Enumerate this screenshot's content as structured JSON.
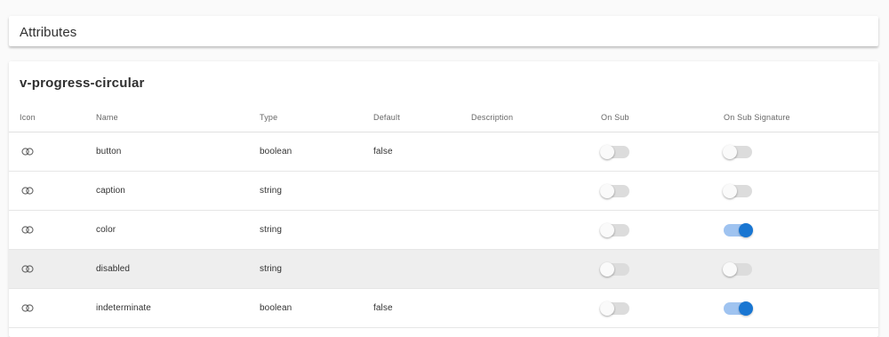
{
  "header": {
    "title": "Attributes"
  },
  "component": {
    "title": "v-progress-circular"
  },
  "table": {
    "columns": [
      "Icon",
      "Name",
      "Type",
      "Default",
      "Description",
      "On Sub",
      "On Sub Signature"
    ],
    "rows": [
      {
        "icon": "rings-icon",
        "name": "button",
        "type": "boolean",
        "default": "false",
        "description": "",
        "on_sub": false,
        "on_sub_signature": false
      },
      {
        "icon": "rings-icon",
        "name": "caption",
        "type": "string",
        "default": "",
        "description": "",
        "on_sub": false,
        "on_sub_signature": false
      },
      {
        "icon": "rings-icon",
        "name": "color",
        "type": "string",
        "default": "",
        "description": "",
        "on_sub": false,
        "on_sub_signature": true
      },
      {
        "icon": "rings-icon",
        "name": "disabled",
        "type": "string",
        "default": "",
        "description": "",
        "on_sub": false,
        "on_sub_signature": false
      },
      {
        "icon": "rings-icon",
        "name": "indeterminate",
        "type": "boolean",
        "default": "false",
        "description": "",
        "on_sub": false,
        "on_sub_signature": true
      }
    ],
    "highlighted_row": 3
  },
  "colors": {
    "accent": "#1976d2",
    "accent_track": "#9fc3f0",
    "toggle_off_track": "#dcdcdc",
    "row_highlight": "#eeeeee"
  }
}
